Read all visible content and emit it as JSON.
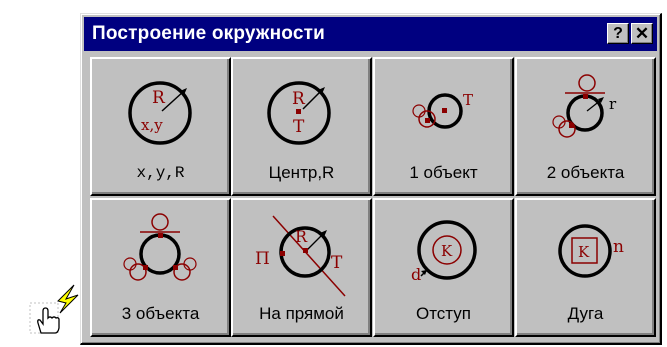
{
  "window": {
    "title": "Построение окружности",
    "help_label": "?",
    "close_label": "✕"
  },
  "buttons": [
    {
      "id": "xyr",
      "label": "x,y,R",
      "glyph_text": [
        "R",
        "x,y"
      ]
    },
    {
      "id": "center-r",
      "label": "Центр,R",
      "glyph_text": [
        "R",
        "T"
      ]
    },
    {
      "id": "one-object",
      "label": "1 объект",
      "glyph_text": [
        "T"
      ]
    },
    {
      "id": "two-objects",
      "label": "2 объекта",
      "glyph_text": [
        "r"
      ]
    },
    {
      "id": "three-objects",
      "label": "3 объекта",
      "glyph_text": []
    },
    {
      "id": "on-line",
      "label": "На прямой",
      "glyph_text": [
        "R",
        "П",
        "T"
      ]
    },
    {
      "id": "offset",
      "label": "Отступ",
      "glyph_text": [
        "K",
        "d"
      ]
    },
    {
      "id": "arc",
      "label": "Дуга",
      "glyph_text": [
        "K",
        "n"
      ]
    }
  ],
  "colors": {
    "title_bar": "#000080",
    "face": "#c0c0c0",
    "accent": "#8b0000"
  },
  "icons": {
    "cursor": "hand-pointer-lightning-icon"
  }
}
